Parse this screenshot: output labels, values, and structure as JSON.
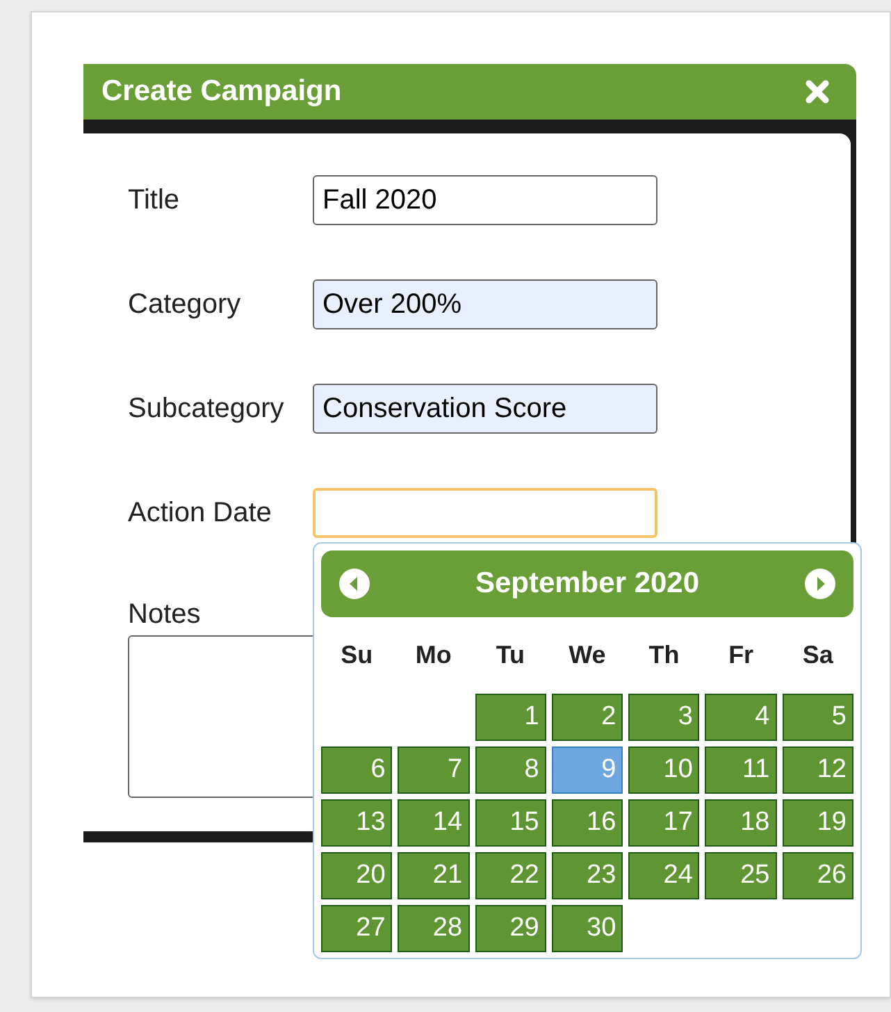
{
  "dialog": {
    "title": "Create Campaign"
  },
  "fields": [
    {
      "label": "Title",
      "value": "Fall 2020",
      "autofilled": false,
      "focused": false
    },
    {
      "label": "Category",
      "value": "Over 200%",
      "autofilled": true,
      "focused": false
    },
    {
      "label": "Subcategory",
      "value": "Conservation Score",
      "autofilled": true,
      "focused": false
    },
    {
      "label": "Action Date",
      "autofilled": false,
      "focused": true
    }
  ],
  "notes": {
    "label": "Notes"
  },
  "calendar": {
    "month": "September 2020",
    "weekdays": [
      "Su",
      "Mo",
      "Tu",
      "We",
      "Th",
      "Fr",
      "Sa"
    ],
    "weeks": [
      [
        {
          "kind": "blank"
        },
        {
          "kind": "blank"
        },
        {
          "kind": "day",
          "label": "1",
          "selected": false
        },
        {
          "kind": "day",
          "label": "2",
          "selected": false
        },
        {
          "kind": "day",
          "label": "3",
          "selected": false
        },
        {
          "kind": "day",
          "label": "4",
          "selected": false
        },
        {
          "kind": "day",
          "label": "5",
          "selected": false
        }
      ],
      [
        {
          "kind": "day",
          "label": "6",
          "selected": false
        },
        {
          "kind": "day",
          "label": "7",
          "selected": false
        },
        {
          "kind": "day",
          "label": "8",
          "selected": false
        },
        {
          "kind": "day",
          "label": "9",
          "selected": true
        },
        {
          "kind": "day",
          "label": "10",
          "selected": false
        },
        {
          "kind": "day",
          "label": "11",
          "selected": false
        },
        {
          "kind": "day",
          "label": "12",
          "selected": false
        }
      ],
      [
        {
          "kind": "day",
          "label": "13",
          "selected": false
        },
        {
          "kind": "day",
          "label": "14",
          "selected": false
        },
        {
          "kind": "day",
          "label": "15",
          "selected": false
        },
        {
          "kind": "day",
          "label": "16",
          "selected": false
        },
        {
          "kind": "day",
          "label": "17",
          "selected": false
        },
        {
          "kind": "day",
          "label": "18",
          "selected": false
        },
        {
          "kind": "day",
          "label": "19",
          "selected": false
        }
      ],
      [
        {
          "kind": "day",
          "label": "20",
          "selected": false
        },
        {
          "kind": "day",
          "label": "21",
          "selected": false
        },
        {
          "kind": "day",
          "label": "22",
          "selected": false
        },
        {
          "kind": "day",
          "label": "23",
          "selected": false
        },
        {
          "kind": "day",
          "label": "24",
          "selected": false
        },
        {
          "kind": "day",
          "label": "25",
          "selected": false
        },
        {
          "kind": "day",
          "label": "26",
          "selected": false
        }
      ],
      [
        {
          "kind": "day",
          "label": "27",
          "selected": false
        },
        {
          "kind": "day",
          "label": "28",
          "selected": false
        },
        {
          "kind": "day",
          "label": "29",
          "selected": false
        },
        {
          "kind": "day",
          "label": "30",
          "selected": false
        },
        {
          "kind": "blank"
        },
        {
          "kind": "blank"
        },
        {
          "kind": "blank"
        }
      ]
    ]
  }
}
